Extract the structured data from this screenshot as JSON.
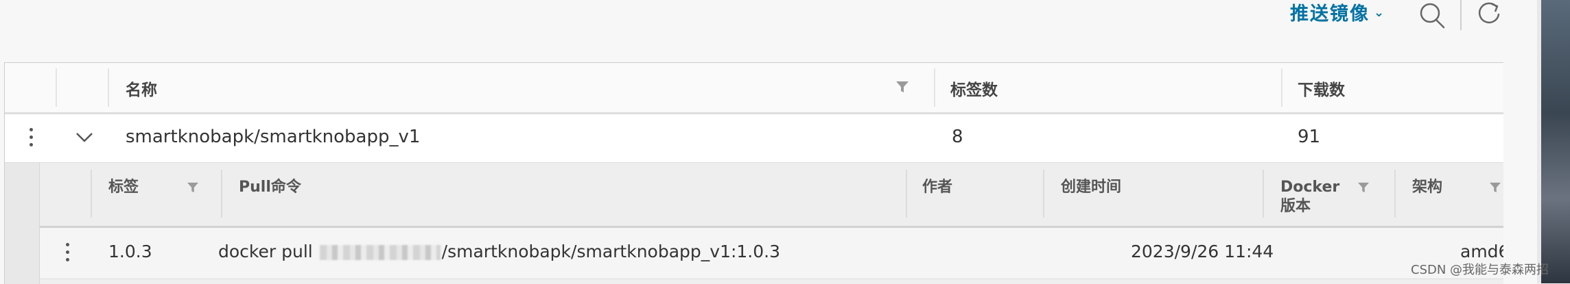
{
  "toolbar": {
    "push_image_label": "推送镜像",
    "push_chevron": "⌄",
    "icons": [
      "search-icon",
      "refresh-icon",
      "chevron-down-icon",
      "filter-icon",
      "kebab-icon"
    ]
  },
  "table": {
    "columns": [
      "名称",
      "标签数",
      "下载数"
    ],
    "rows": [
      {
        "name": "smartknobapk/smartknobapp_v1",
        "tags": "8",
        "downloads": "91"
      }
    ]
  },
  "detail": {
    "columns": [
      "标签",
      "Pull命令",
      "作者",
      "创建时间",
      "Docker\n版本",
      "架构"
    ],
    "docker_version_line1": "Docker",
    "docker_version_line2": "版本",
    "rows": [
      {
        "tag": "1.0.3",
        "pull_prefix": "docker pull",
        "pull_suffix": "/smartknobapk/smartknobapp_v1:1.0.3",
        "author": "",
        "created": "2023/9/26 11:44",
        "arch": "amd6"
      }
    ]
  },
  "watermark": "CSDN @我能与泰森两招",
  "colors": {
    "accent": "#0072a3"
  }
}
